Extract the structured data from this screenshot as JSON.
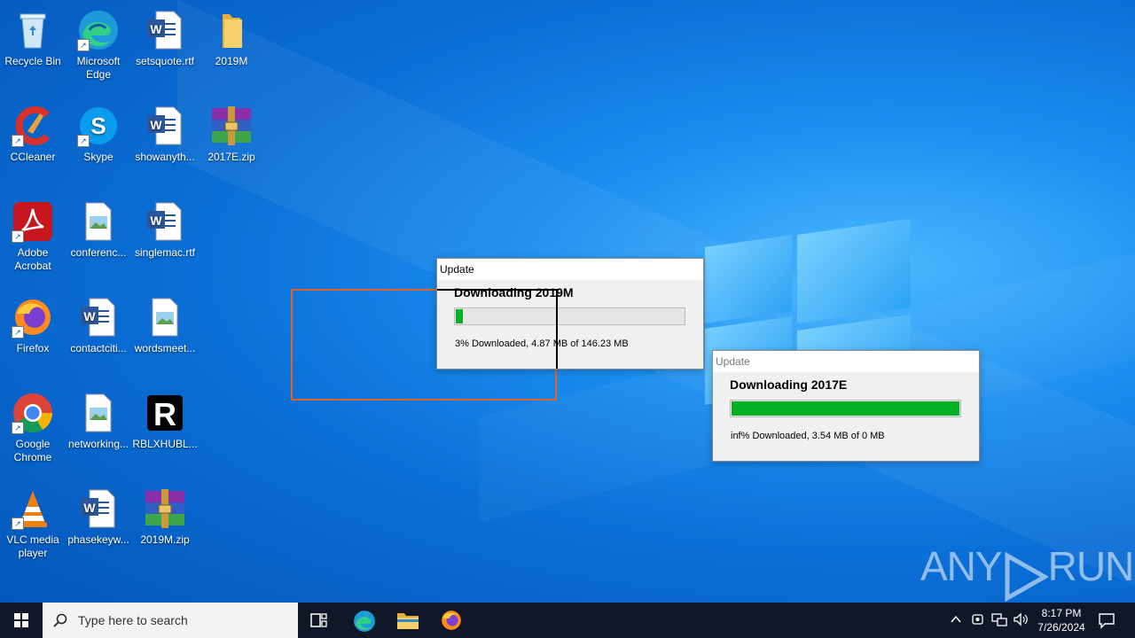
{
  "desktop": {
    "icons": [
      {
        "label": "Recycle Bin",
        "icon": "recycle-bin-icon"
      },
      {
        "label": "Microsoft Edge",
        "icon": "edge-icon"
      },
      {
        "label": "setsquote.rtf",
        "icon": "word-doc-icon"
      },
      {
        "label": "2019M",
        "icon": "folder-icon"
      },
      {
        "label": "CCleaner",
        "icon": "ccleaner-icon"
      },
      {
        "label": "Skype",
        "icon": "skype-icon"
      },
      {
        "label": "showanyth...",
        "icon": "word-doc-icon"
      },
      {
        "label": "2017E.zip",
        "icon": "winrar-archive-icon"
      },
      {
        "label": "Adobe Acrobat",
        "icon": "acrobat-icon"
      },
      {
        "label": "conferenc...",
        "icon": "image-file-icon"
      },
      {
        "label": "singlemac.rtf",
        "icon": "word-doc-icon"
      },
      {
        "label": "Firefox",
        "icon": "firefox-icon"
      },
      {
        "label": "contactciti...",
        "icon": "word-doc-icon"
      },
      {
        "label": "wordsmeet...",
        "icon": "image-file-icon"
      },
      {
        "label": "Google Chrome",
        "icon": "chrome-icon"
      },
      {
        "label": "networking...",
        "icon": "image-file-icon"
      },
      {
        "label": "RBLXHUBL...",
        "icon": "roblox-icon"
      },
      {
        "label": "VLC media player",
        "icon": "vlc-icon"
      },
      {
        "label": "phasekeyw...",
        "icon": "word-doc-icon"
      },
      {
        "label": "2019M.zip",
        "icon": "winrar-archive-icon"
      }
    ]
  },
  "dialog1": {
    "title": "Update",
    "heading": "Downloading 2019M",
    "progress": 0.03,
    "status": "3% Downloaded, 4.87 MB of 146.23 MB"
  },
  "dialog2": {
    "title": "Update",
    "heading": "Downloading 2017E",
    "progress": 1.0,
    "status": "inf% Downloaded, 3.54 MB of 0 MB"
  },
  "watermark": {
    "left": "ANY",
    "right": "RUN"
  },
  "taskbar": {
    "search_placeholder": "Type here to search",
    "time": "8:17 PM",
    "date": "7/26/2024"
  },
  "colors": {
    "progress_green": "#06b025",
    "selection_rect": "#e0642a",
    "taskbar": "#101828"
  }
}
